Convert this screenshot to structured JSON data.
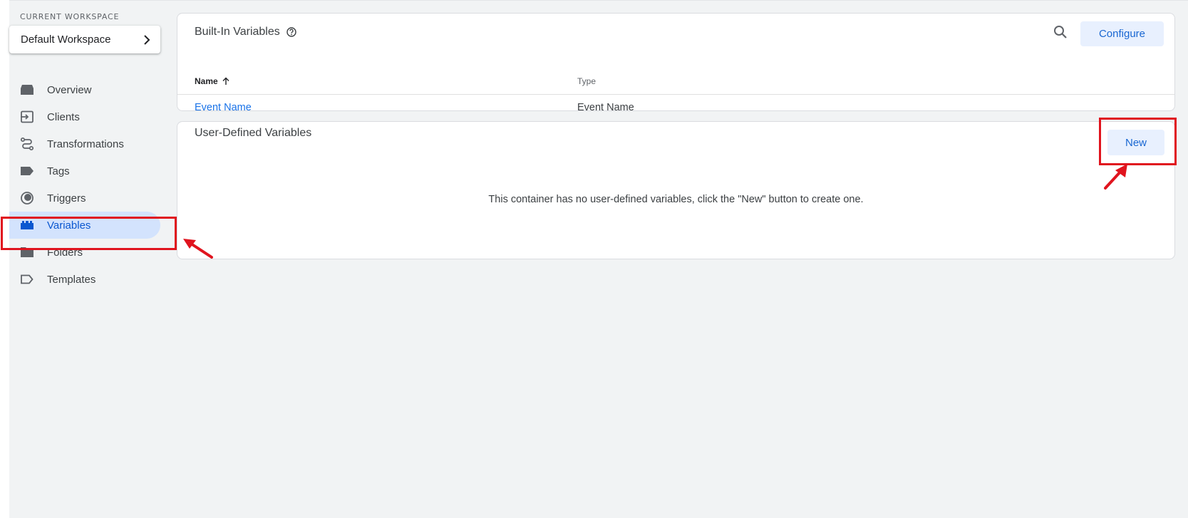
{
  "sidebar": {
    "workspace_label": "CURRENT WORKSPACE",
    "workspace_name": "Default Workspace",
    "items": [
      {
        "label": "Overview",
        "icon": "overview-icon"
      },
      {
        "label": "Clients",
        "icon": "clients-icon"
      },
      {
        "label": "Transformations",
        "icon": "transformations-icon"
      },
      {
        "label": "Tags",
        "icon": "tag-icon"
      },
      {
        "label": "Triggers",
        "icon": "trigger-icon"
      },
      {
        "label": "Variables",
        "icon": "variables-icon",
        "active": true
      },
      {
        "label": "Folders",
        "icon": "folder-icon"
      },
      {
        "label": "Templates",
        "icon": "template-icon"
      }
    ]
  },
  "builtin": {
    "title": "Built-In Variables",
    "configure_label": "Configure",
    "columns": {
      "name": "Name",
      "type": "Type"
    },
    "rows": [
      {
        "name": "Event Name",
        "type": "Event Name"
      }
    ]
  },
  "user_defined": {
    "title": "User-Defined Variables",
    "new_label": "New",
    "empty_message": "This container has no user-defined variables, click the \"New\" button to create one."
  },
  "colors": {
    "accent": "#1a73e8",
    "active_nav_bg": "#d3e3fd",
    "annotation": "#e0141e"
  }
}
